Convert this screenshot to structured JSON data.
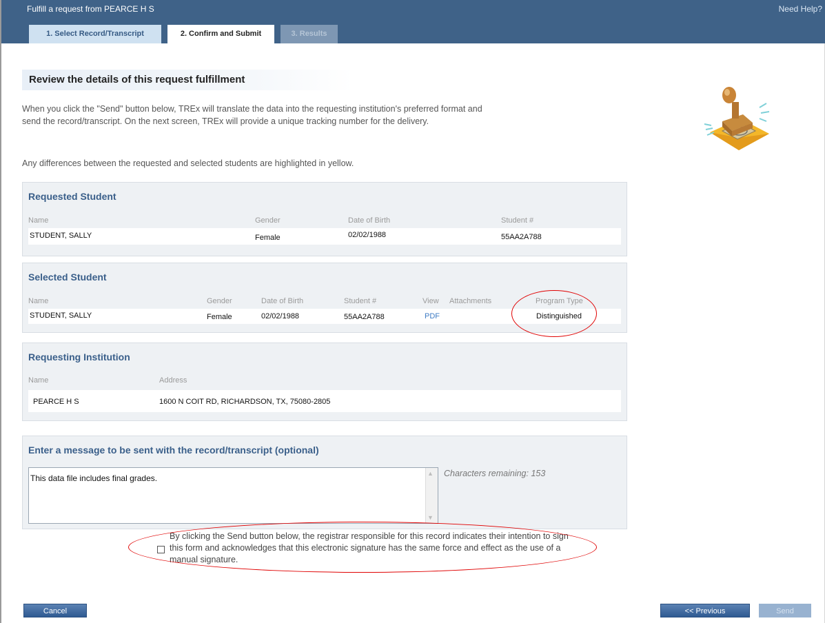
{
  "header": {
    "title": "Fulfill a request from PEARCE H S",
    "help": "Need Help?",
    "tabs": [
      {
        "label": "1. Select Record/Transcript",
        "state": "completed"
      },
      {
        "label": "2. Confirm and Submit",
        "state": "active"
      },
      {
        "label": "3. Results",
        "state": "disabled"
      }
    ]
  },
  "page": {
    "heading": "Review the details of this request fulfillment",
    "intro": "When you click the \"Send\" button below, TREx will translate the data into the requesting institution's preferred format and send the record/transcript. On the next screen, TREx will provide a unique tracking number for the delivery.",
    "note": "Any differences between the requested and selected students are highlighted in yellow."
  },
  "requested_student": {
    "title": "Requested Student",
    "columns": {
      "name": "Name",
      "gender": "Gender",
      "dob": "Date of Birth",
      "student_no": "Student #"
    },
    "row": {
      "name": "STUDENT, SALLY",
      "gender": "Female",
      "dob": "02/02/1988",
      "student_no": "55AA2A788"
    }
  },
  "selected_student": {
    "title": "Selected Student",
    "columns": {
      "name": "Name",
      "gender": "Gender",
      "dob": "Date of Birth",
      "student_no": "Student #",
      "view": "View",
      "attachments": "Attachments",
      "program_type": "Program Type"
    },
    "row": {
      "name": "STUDENT, SALLY",
      "gender": "Female",
      "dob": "02/02/1988",
      "student_no": "55AA2A788",
      "view": "PDF",
      "attachments": "",
      "program_type": "Distinguished"
    }
  },
  "institution": {
    "title": "Requesting Institution",
    "columns": {
      "name": "Name",
      "address": "Address"
    },
    "row": {
      "name": "PEARCE H S",
      "address": "1600 N COIT RD, RICHARDSON, TX, 75080-2805"
    }
  },
  "message": {
    "title": "Enter a message to be sent with the record/transcript (optional)",
    "value": "This data file includes final grades.",
    "chars_label": "Characters remaining:",
    "chars_remaining": "153"
  },
  "agreement": {
    "checked": false,
    "text": "By clicking the Send button below, the registrar responsible for this record indicates their intention to sign this form and acknowledges that this electronic signature has the same force and effect as the use of a manual signature."
  },
  "buttons": {
    "cancel": "Cancel",
    "previous": "<< Previous",
    "send": "Send"
  },
  "colors": {
    "header": "#3f6288",
    "panel_title": "#3a5f8a",
    "annotation": "#e00000",
    "link": "#3d7bc4"
  }
}
